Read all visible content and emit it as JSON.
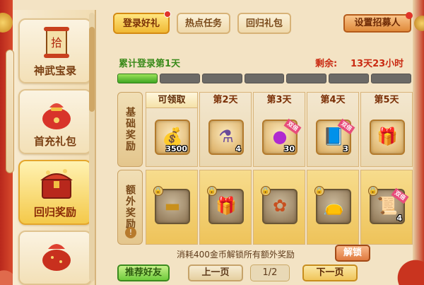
{
  "sidebar": {
    "items": [
      {
        "label": "神武宝录",
        "icon": "scroll-icon"
      },
      {
        "label": "首充礼包",
        "icon": "gift-bag-icon"
      },
      {
        "label": "回归奖励",
        "icon": "treasure-chest-icon"
      },
      {
        "label": "",
        "icon": "lucky-bag-icon"
      }
    ],
    "active_index": 2
  },
  "tabs": [
    {
      "label": "登录好礼",
      "active": true
    },
    {
      "label": "热点任务",
      "active": false
    },
    {
      "label": "回归礼包",
      "active": false
    }
  ],
  "recruit_button": "设置招募人",
  "login_status": "累计登录第1天",
  "remaining": {
    "label": "剩余:",
    "value": "13天23小时"
  },
  "progress": {
    "total_segments": 7,
    "filled_segments": 1
  },
  "rows": {
    "basic": "基础奖励",
    "extra": "额外奖励"
  },
  "days": [
    {
      "label": "可领取",
      "claimable": true
    },
    {
      "label": "第2天",
      "claimable": false
    },
    {
      "label": "第3天",
      "claimable": false
    },
    {
      "label": "第4天",
      "claimable": false
    },
    {
      "label": "第5天",
      "claimable": false
    }
  ],
  "basic_rewards": [
    {
      "icon": "gold-bars-icon",
      "qty": "3500",
      "badge": ""
    },
    {
      "icon": "potion-bottle-icon",
      "qty": "4",
      "badge": ""
    },
    {
      "icon": "purple-orb-icon",
      "qty": "30",
      "badge": "双倍"
    },
    {
      "icon": "blue-scroll-icon",
      "qty": "3",
      "badge": "双倍"
    },
    {
      "icon": "gift-box-icon",
      "qty": "",
      "badge": ""
    }
  ],
  "extra_rewards": [
    {
      "icon": "gold-bar-icon",
      "qty": "",
      "badge": ""
    },
    {
      "icon": "gift-box-icon",
      "qty": "",
      "badge": ""
    },
    {
      "icon": "jade-pendant-icon",
      "qty": "",
      "badge": ""
    },
    {
      "icon": "red-bag-icon",
      "qty": "",
      "badge": ""
    },
    {
      "icon": "gold-scroll-icon",
      "qty": "4",
      "badge": "双倍"
    }
  ],
  "unlock_note": "消耗400金币解锁所有额外奖励",
  "unlock_button": "解锁",
  "recommend_button": "推荐好友",
  "prev_button": "上一页",
  "page_indicator": "1/2",
  "next_button": "下一页",
  "colors": {
    "accent": "#f0b833",
    "progress_fill": "#3fa723",
    "remaining": "#c92a12",
    "login": "#3a8a1a"
  }
}
